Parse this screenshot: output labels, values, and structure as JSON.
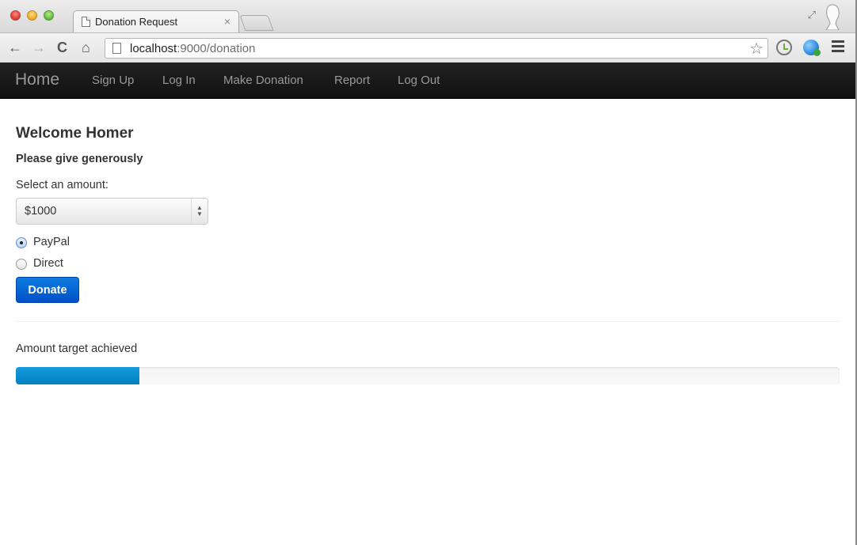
{
  "browser": {
    "tab_title": "Donation Request",
    "tab_close": "×",
    "url_host": "localhost",
    "url_rest": ":9000/donation",
    "icons": {
      "back": "←",
      "forward": "→",
      "reload": "C",
      "home": "⌂",
      "star": "☆",
      "fullscreen": "⤢"
    }
  },
  "navbar": {
    "brand": "Home",
    "links": [
      "Sign Up",
      "Log In",
      "Make Donation",
      "Report",
      "Log Out"
    ]
  },
  "main": {
    "heading": "Welcome Homer",
    "subheading": "Please give generously",
    "amount_label": "Select an amount:",
    "amount_selected": "$1000",
    "payment_options": [
      {
        "label": "PayPal",
        "checked": true
      },
      {
        "label": "Direct",
        "checked": false
      }
    ],
    "donate_label": "Donate",
    "progress_label": "Amount target achieved",
    "progress_fraction": 0.15,
    "accent_color": "#0e7ce0",
    "progress_color": "#149bdf"
  }
}
